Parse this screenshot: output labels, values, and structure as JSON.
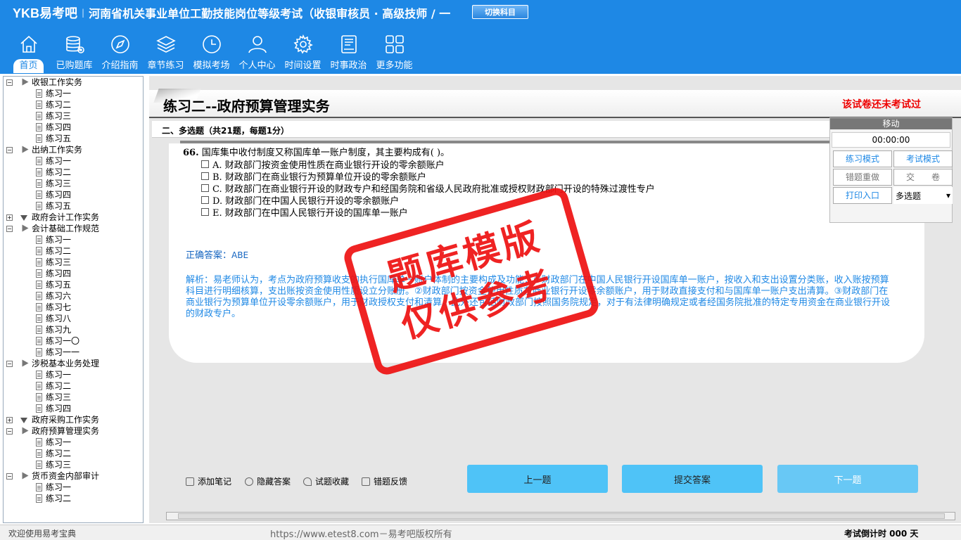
{
  "header": {
    "logo": "YKB易考吧",
    "title": "河南省机关事业单位工勤技能岗位等级考试（收银审核员 · 高级技师 / 一",
    "switch_label": "切换科目",
    "nav": [
      {
        "label": "首页",
        "icon": "home-icon"
      },
      {
        "label": "已购题库",
        "icon": "database-icon"
      },
      {
        "label": "介绍指南",
        "icon": "compass-icon"
      },
      {
        "label": "章节练习",
        "icon": "layers-icon"
      },
      {
        "label": "模拟考场",
        "icon": "clock-icon"
      },
      {
        "label": "个人中心",
        "icon": "user-icon"
      },
      {
        "label": "时间设置",
        "icon": "gear-icon"
      },
      {
        "label": "时事政治",
        "icon": "news-icon"
      },
      {
        "label": "更多功能",
        "icon": "grid-icon"
      }
    ]
  },
  "sidebar": {
    "groups": [
      {
        "label": "收银工作实务",
        "expanded": true,
        "items": [
          "练习一",
          "练习二",
          "练习三",
          "练习四",
          "练习五"
        ]
      },
      {
        "label": "出纳工作实务",
        "expanded": true,
        "items": [
          "练习一",
          "练习二",
          "练习三",
          "练习四",
          "练习五"
        ]
      },
      {
        "label": "政府会计工作实务",
        "expanded": false,
        "items": []
      },
      {
        "label": "会计基础工作规范",
        "expanded": true,
        "items": [
          "练习一",
          "练习二",
          "练习三",
          "练习四",
          "练习五",
          "练习六",
          "练习七",
          "练习八",
          "练习九",
          "练习一〇",
          "练习一一"
        ]
      },
      {
        "label": "涉税基本业务处理",
        "expanded": true,
        "items": [
          "练习一",
          "练习二",
          "练习三",
          "练习四"
        ]
      },
      {
        "label": "政府采购工作实务",
        "expanded": false,
        "items": []
      },
      {
        "label": "政府预算管理实务",
        "expanded": true,
        "items": [
          "练习一",
          "练习二",
          "练习三"
        ]
      },
      {
        "label": "货币资金内部审计",
        "expanded": true,
        "items": [
          "练习一",
          "练习二"
        ]
      }
    ]
  },
  "main": {
    "title": "练习二--政府预算管理实务",
    "status": "该试卷还未考试过",
    "section": "二、多选题（共21题，每题1分）",
    "question": {
      "number": "66.",
      "text": "国库集中收付制度又称国库单一账户制度，其主要构成有( )。",
      "options": [
        "A. 财政部门按资金使用性质在商业银行开设的零余额账户",
        "B. 财政部门在商业银行为预算单位开设的零余额账户",
        "C. 财政部门在商业银行开设的财政专户和经国务院和省级人民政府批准或授权财政部门开设的特殊过渡性专户",
        "D. 财政部门在中国人民银行开设的零余额账户",
        "E. 财政部门在中国人民银行开设的国库单一账户"
      ]
    },
    "answer_label": "正确答案：",
    "answer_value": "ABE",
    "analysis": "解析：易老师认为，考点为政府预算收支的执行国库单一账户体制的主要构成及功能：①财政部门在中国人民银行开设国库单一账户，按收入和支出设置分类账，收入账按预算科目进行明细核算，支出账按资金使用性质设立分账册。②财政部门按资金使用性质在商业银行开设零余额账户，用于财政直接支付和与国库单一账户支出清算。③财政部门在商业银行为预算单位开设零余额账户，用于财政授权支付和清算。此外还包括财政部门按照国务院规定，对于有法律明确规定或者经国务院批准的特定专用资金在商业银行开设的财政专户。",
    "tools": [
      "添加笔记",
      "隐藏答案",
      "试题收藏",
      "错题反馈"
    ],
    "buttons": {
      "prev": "上一题",
      "submit": "提交答案",
      "next": "下一题"
    }
  },
  "right_panel": {
    "move_label": "移动",
    "timer": "00:00:00",
    "practice_mode": "练习模式",
    "exam_mode": "考试模式",
    "redo_wrong": "错题重做",
    "submit_paper": "交　　卷",
    "print_entry": "打印入口",
    "question_type": "多选题"
  },
  "watermark": [
    "题库模版",
    "仅供参考"
  ],
  "statusbar": {
    "welcome": "欢迎使用易考宝典",
    "site": "https://www.etest8.com－易考吧版权所有",
    "countdown": "考试倒计时 000 天"
  },
  "colors": {
    "brand": "#1e88e5",
    "button": "#4fc3f7",
    "stamp": "#e11111",
    "status_red": "#e00000"
  }
}
